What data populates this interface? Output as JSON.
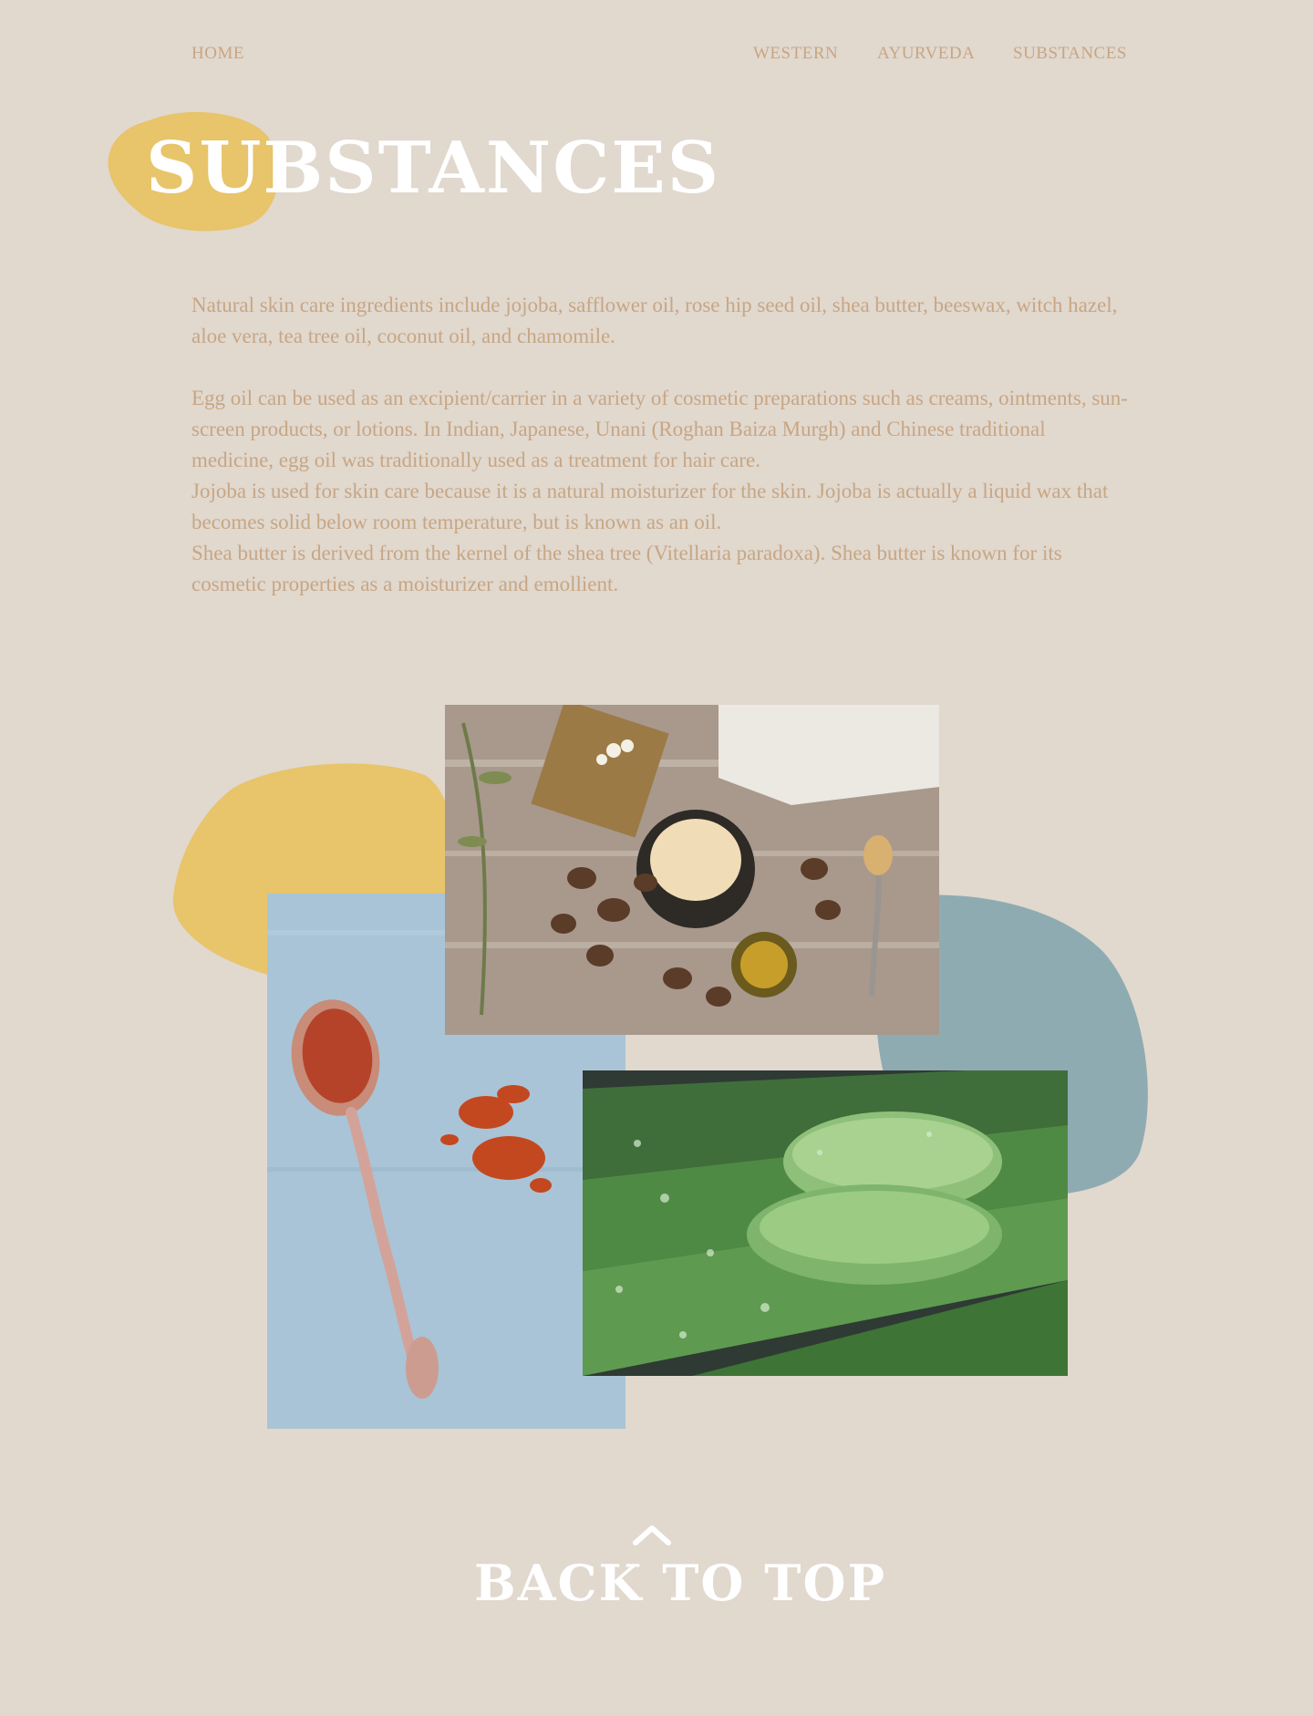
{
  "nav": {
    "home": "HOME",
    "western": "WESTERN",
    "ayurveda": "AYURVEDA",
    "substances": "SUBSTANCES"
  },
  "page": {
    "title": "SUBSTANCES"
  },
  "intro": {
    "paragraph_1": "Natural skin care ingredients include jojoba, safflower oil, rose hip seed oil, shea butter, beeswax, witch hazel, aloe vera, tea tree oil, coconut oil, and chamomile.",
    "paragraph_2": "Egg oil can be used as an excipient/carrier in a variety of cosmetic preparations such as creams, ointments, sun-screen products, or lotions. In Indian, Japanese, Unani (Roghan Baiza Murgh) and Chinese traditional medicine, egg oil was traditionally used as a treatment for hair care.",
    "paragraph_3": "Jojoba is used for skin care because it is a natural moisturizer for the skin. Jojoba is actually a liquid wax that becomes solid below room temperature, but is known as an oil.",
    "paragraph_4": "Shea butter is derived from the kernel of the shea tree (Vitellaria paradoxa). Shea butter is known for its cosmetic properties as a moisturizer and emollient."
  },
  "gallery": {
    "photos": [
      "shea-butter-photo",
      "saffron-spoon-photo",
      "aloe-vera-photo"
    ]
  },
  "footer": {
    "back_to_top": "BACK TO TOP",
    "icon": "chevron-up-icon"
  },
  "colors": {
    "background": "#e1d8ce",
    "accent_yellow": "#e8c46a",
    "accent_blue": "#8fabb2",
    "text_tan": "#c7a684",
    "heading_white": "#ffffff"
  }
}
